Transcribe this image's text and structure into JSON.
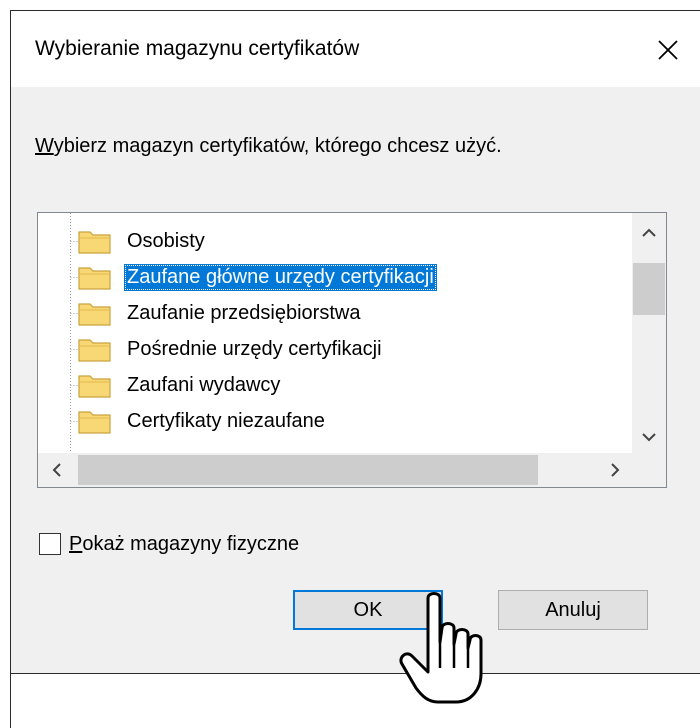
{
  "dialog": {
    "title": "Wybieranie magazynu certyfikatów",
    "prompt_mnemonic": "W",
    "prompt_rest": "ybierz magazyn certyfikatów, którego chcesz użyć."
  },
  "tree": {
    "selected_index": 1,
    "items": [
      {
        "label": "Osobisty"
      },
      {
        "label": "Zaufane główne urzędy certyfikacji"
      },
      {
        "label": "Zaufanie przedsiębiorstwa"
      },
      {
        "label": "Pośrednie urzędy certyfikacji"
      },
      {
        "label": "Zaufani wydawcy"
      },
      {
        "label": "Certyfikaty niezaufane"
      }
    ]
  },
  "checkbox": {
    "mnemonic": "P",
    "label_rest": "okaż magazyny fizyczne",
    "checked": false
  },
  "buttons": {
    "ok": "OK",
    "cancel": "Anuluj"
  },
  "icons": {
    "close": "close-icon",
    "folder": "folder-icon",
    "cursor": "hand-pointer-icon"
  },
  "colors": {
    "selection": "#0078d7",
    "client_bg": "#f0f0f0",
    "folder_fill": "#f8d775"
  }
}
